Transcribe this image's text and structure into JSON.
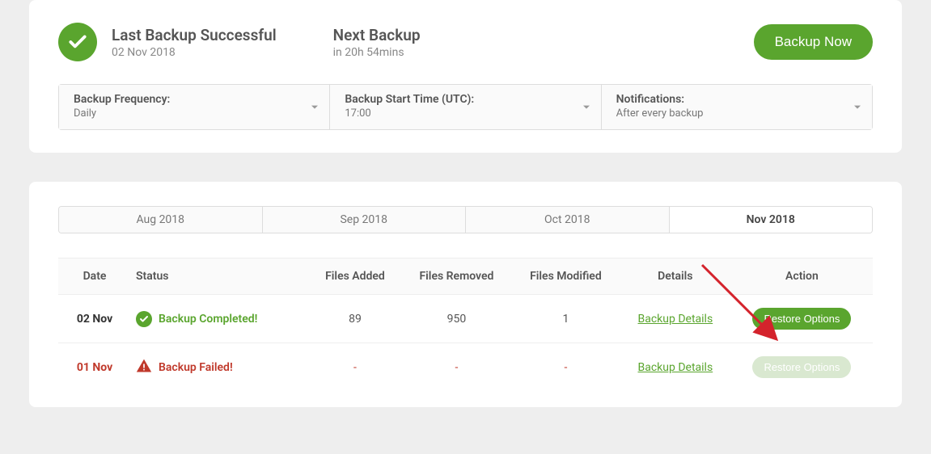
{
  "header": {
    "last_backup_title": "Last Backup Successful",
    "last_backup_date": "02 Nov 2018",
    "next_backup_title": "Next Backup",
    "next_backup_in": "in 20h 54mins",
    "backup_now_label": "Backup Now"
  },
  "settings": {
    "frequency_label": "Backup Frequency:",
    "frequency_value": "Daily",
    "start_label": "Backup Start Time (UTC):",
    "start_value": "17:00",
    "notif_label": "Notifications:",
    "notif_value": "After every backup"
  },
  "tabs": [
    "Aug 2018",
    "Sep 2018",
    "Oct 2018",
    "Nov 2018"
  ],
  "tabs_current_index": 3,
  "table": {
    "columns": [
      "Date",
      "Status",
      "Files Added",
      "Files Removed",
      "Files Modified",
      "Details",
      "Action"
    ],
    "details_link_label": "Backup Details",
    "restore_label": "Restore Options",
    "rows": [
      {
        "date": "02 Nov",
        "status_label": "Backup Completed!",
        "status_kind": "ok",
        "files_added": "89",
        "files_removed": "950",
        "files_modified": "1",
        "restore_enabled": true
      },
      {
        "date": "01 Nov",
        "status_label": "Backup Failed!",
        "status_kind": "fail",
        "files_added": "-",
        "files_removed": "-",
        "files_modified": "-",
        "restore_enabled": false
      }
    ]
  },
  "colors": {
    "accent_green": "#5aa52e",
    "fail_red": "#c0392b"
  }
}
